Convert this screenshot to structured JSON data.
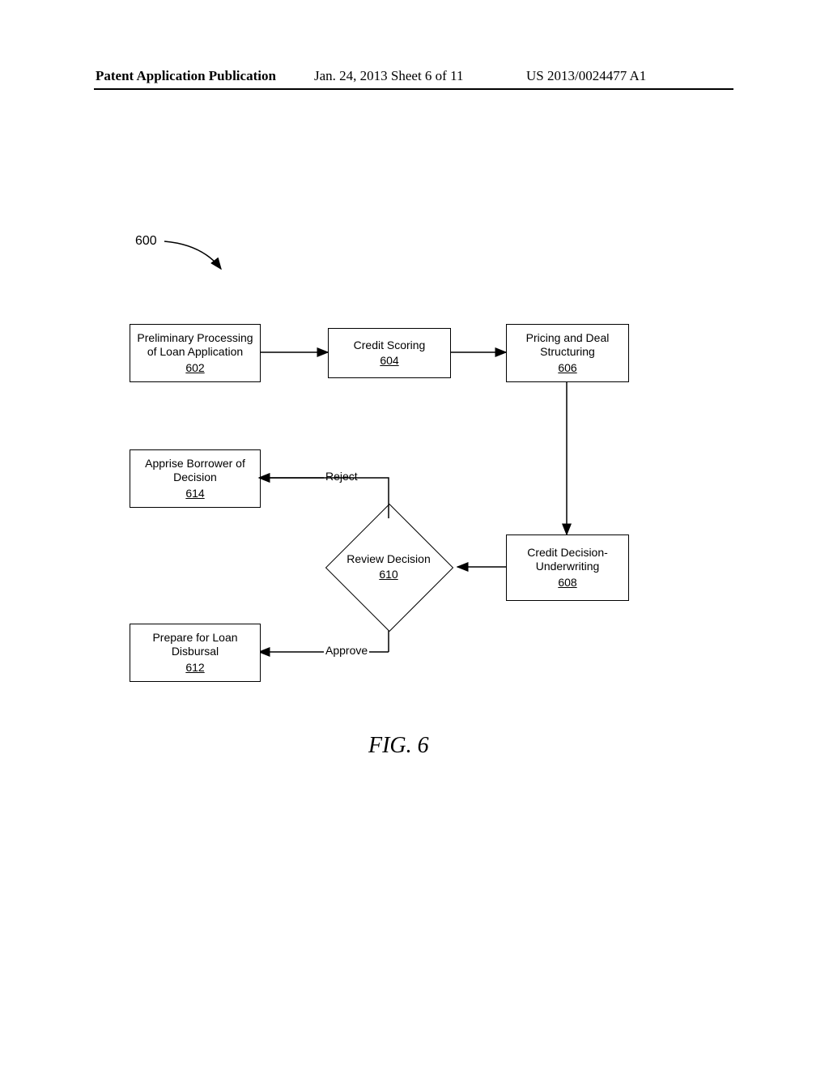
{
  "header": {
    "left": "Patent Application Publication",
    "center": "Jan. 24, 2013  Sheet 6 of 11",
    "right": "US 2013/0024477 A1"
  },
  "ref": {
    "label": "600"
  },
  "boxes": {
    "b602": {
      "title1": "Preliminary Processing",
      "title2": "of Loan Application",
      "num": "602"
    },
    "b604": {
      "title1": "Credit Scoring",
      "num": "604"
    },
    "b606": {
      "title1": "Pricing and Deal",
      "title2": "Structuring",
      "num": "606"
    },
    "b608": {
      "title1": "Credit Decision-",
      "title2": "Underwriting",
      "num": "608"
    },
    "b610": {
      "title1": "Review Decision",
      "num": "610"
    },
    "b612": {
      "title1": "Prepare for Loan",
      "title2": "Disbursal",
      "num": "612"
    },
    "b614": {
      "title1": "Apprise Borrower of",
      "title2": "Decision",
      "num": "614"
    }
  },
  "edges": {
    "reject": "Reject",
    "approve": "Approve"
  },
  "figure_caption": "FIG. 6",
  "chart_data": {
    "type": "flowchart",
    "nodes": [
      {
        "id": "602",
        "label": "Preliminary Processing of Loan Application",
        "shape": "process"
      },
      {
        "id": "604",
        "label": "Credit Scoring",
        "shape": "process"
      },
      {
        "id": "606",
        "label": "Pricing and Deal Structuring",
        "shape": "process"
      },
      {
        "id": "608",
        "label": "Credit Decision- Underwriting",
        "shape": "process"
      },
      {
        "id": "610",
        "label": "Review Decision",
        "shape": "decision"
      },
      {
        "id": "612",
        "label": "Prepare for Loan Disbursal",
        "shape": "process"
      },
      {
        "id": "614",
        "label": "Apprise Borrower of Decision",
        "shape": "process"
      }
    ],
    "edges": [
      {
        "from": "602",
        "to": "604",
        "label": ""
      },
      {
        "from": "604",
        "to": "606",
        "label": ""
      },
      {
        "from": "606",
        "to": "608",
        "label": ""
      },
      {
        "from": "608",
        "to": "610",
        "label": ""
      },
      {
        "from": "610",
        "to": "614",
        "label": "Reject"
      },
      {
        "from": "610",
        "to": "612",
        "label": "Approve"
      }
    ],
    "reference_numeral": "600",
    "title": "FIG. 6"
  }
}
